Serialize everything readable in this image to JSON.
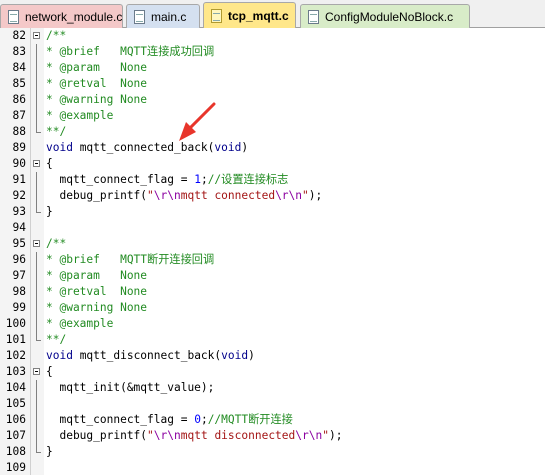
{
  "tabs": [
    {
      "label": "network_module.c",
      "active": false,
      "color": "#f4c8c8"
    },
    {
      "label": "main.c",
      "active": false,
      "color": "#d4e0f0"
    },
    {
      "label": "tcp_mqtt.c",
      "active": true,
      "color": "#ffe78a"
    },
    {
      "label": "ConfigModuleNoBlock.c",
      "active": false,
      "color": "#d8ecc8"
    }
  ],
  "lines": [
    {
      "num": "82",
      "code": "/**"
    },
    {
      "num": "83",
      "code": "* @brief   MQTT连接成功回调"
    },
    {
      "num": "84",
      "code": "* @param   None"
    },
    {
      "num": "85",
      "code": "* @retval  None"
    },
    {
      "num": "86",
      "code": "* @warning None"
    },
    {
      "num": "87",
      "code": "* @example"
    },
    {
      "num": "88",
      "code": "**/"
    },
    {
      "num": "89",
      "code": "void mqtt_connected_back(void)"
    },
    {
      "num": "90",
      "code": "{"
    },
    {
      "num": "91",
      "code": "  mqtt_connect_flag = 1;//设置连接标志"
    },
    {
      "num": "92",
      "code": "  debug_printf(\"\\r\\nmqtt connected\\r\\n\");"
    },
    {
      "num": "93",
      "code": "}"
    },
    {
      "num": "94",
      "code": ""
    },
    {
      "num": "95",
      "code": "/**"
    },
    {
      "num": "96",
      "code": "* @brief   MQTT断开连接回调"
    },
    {
      "num": "97",
      "code": "* @param   None"
    },
    {
      "num": "98",
      "code": "* @retval  None"
    },
    {
      "num": "99",
      "code": "* @warning None"
    },
    {
      "num": "100",
      "code": "* @example"
    },
    {
      "num": "101",
      "code": "**/"
    },
    {
      "num": "102",
      "code": "void mqtt_disconnect_back(void)"
    },
    {
      "num": "103",
      "code": "{"
    },
    {
      "num": "104",
      "code": "  mqtt_init(&mqtt_value);"
    },
    {
      "num": "105",
      "code": ""
    },
    {
      "num": "106",
      "code": "  mqtt_connect_flag = 0;//MQTT断开连接"
    },
    {
      "num": "107",
      "code": "  debug_printf(\"\\r\\nmqtt disconnected\\r\\n\");"
    },
    {
      "num": "108",
      "code": "}"
    },
    {
      "num": "109",
      "code": ""
    }
  ],
  "colors": {
    "comment": "#228b22",
    "keyword": "#00008b",
    "number": "#0000ff",
    "annotation_arrow": "#e8352b"
  }
}
